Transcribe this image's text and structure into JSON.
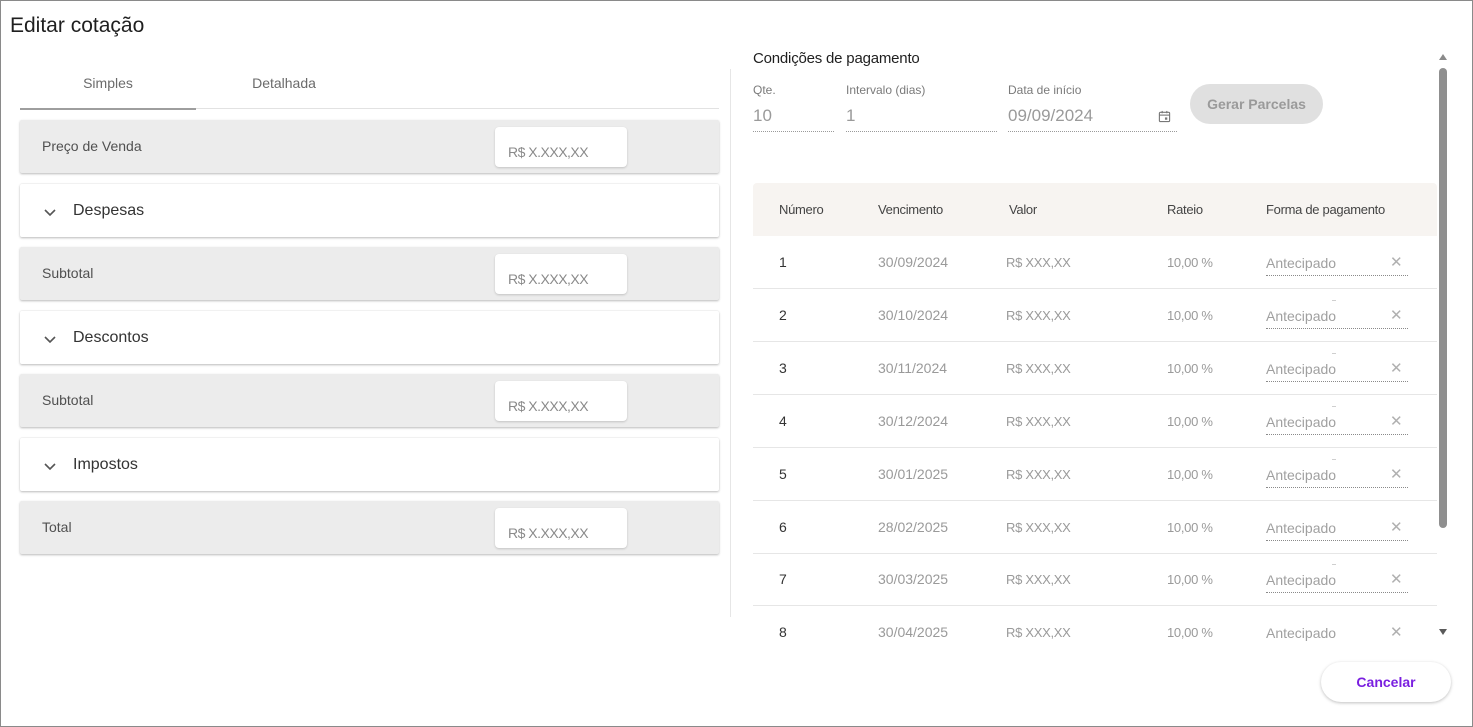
{
  "dialog": {
    "title": "Editar cotação"
  },
  "tabs": [
    {
      "label": "Simples",
      "active": true
    },
    {
      "label": "Detalhada",
      "active": false
    }
  ],
  "left_rows": [
    {
      "type": "value",
      "label": "Preço de Venda",
      "value": "R$ X.XXX,XX"
    },
    {
      "type": "section",
      "label": "Despesas"
    },
    {
      "type": "value",
      "label": "Subtotal",
      "value": "R$ X.XXX,XX"
    },
    {
      "type": "section",
      "label": "Descontos"
    },
    {
      "type": "value",
      "label": "Subtotal",
      "value": "R$ X.XXX,XX"
    },
    {
      "type": "section",
      "label": "Impostos"
    },
    {
      "type": "value",
      "label": "Total",
      "value": "R$ X.XXX,XX"
    }
  ],
  "payment": {
    "title": "Condições de pagamento",
    "fields": {
      "qte": {
        "label": "Qte.",
        "value": "10"
      },
      "intervalo": {
        "label": "Intervalo (dias)",
        "value": "1"
      },
      "data_inicio": {
        "label": "Data de início",
        "value": "09/09/2024"
      }
    },
    "generate_button": "Gerar Parcelas",
    "table": {
      "headers": [
        "Número",
        "Vencimento",
        "Valor",
        "Rateio",
        "Forma de pagamento"
      ],
      "rows": [
        {
          "numero": "1",
          "vencimento": "30/09/2024",
          "valor": "R$ XXX,XX",
          "rateio": "10,00 %",
          "forma": "Antecipado"
        },
        {
          "numero": "2",
          "vencimento": "30/10/2024",
          "valor": "R$ XXX,XX",
          "rateio": "10,00 %",
          "forma": "Antecipado"
        },
        {
          "numero": "3",
          "vencimento": "30/11/2024",
          "valor": "R$ XXX,XX",
          "rateio": "10,00 %",
          "forma": "Antecipado"
        },
        {
          "numero": "4",
          "vencimento": "30/12/2024",
          "valor": "R$ XXX,XX",
          "rateio": "10,00 %",
          "forma": "Antecipado"
        },
        {
          "numero": "5",
          "vencimento": "30/01/2025",
          "valor": "R$ XXX,XX",
          "rateio": "10,00 %",
          "forma": "Antecipado"
        },
        {
          "numero": "6",
          "vencimento": "28/02/2025",
          "valor": "R$ XXX,XX",
          "rateio": "10,00 %",
          "forma": "Antecipado"
        },
        {
          "numero": "7",
          "vencimento": "30/03/2025",
          "valor": "R$ XXX,XX",
          "rateio": "10,00 %",
          "forma": "Antecipado"
        },
        {
          "numero": "8",
          "vencimento": "30/04/2025",
          "valor": "R$ XXX,XX",
          "rateio": "10,00 %",
          "forma": "Antecipado"
        }
      ],
      "clear_icon": "close-icon"
    }
  },
  "footer": {
    "cancel_label": "Cancelar"
  },
  "colors": {
    "accent": "#7a1fe0",
    "row_gray": "#ececec",
    "table_head": "#f7f4f1"
  }
}
